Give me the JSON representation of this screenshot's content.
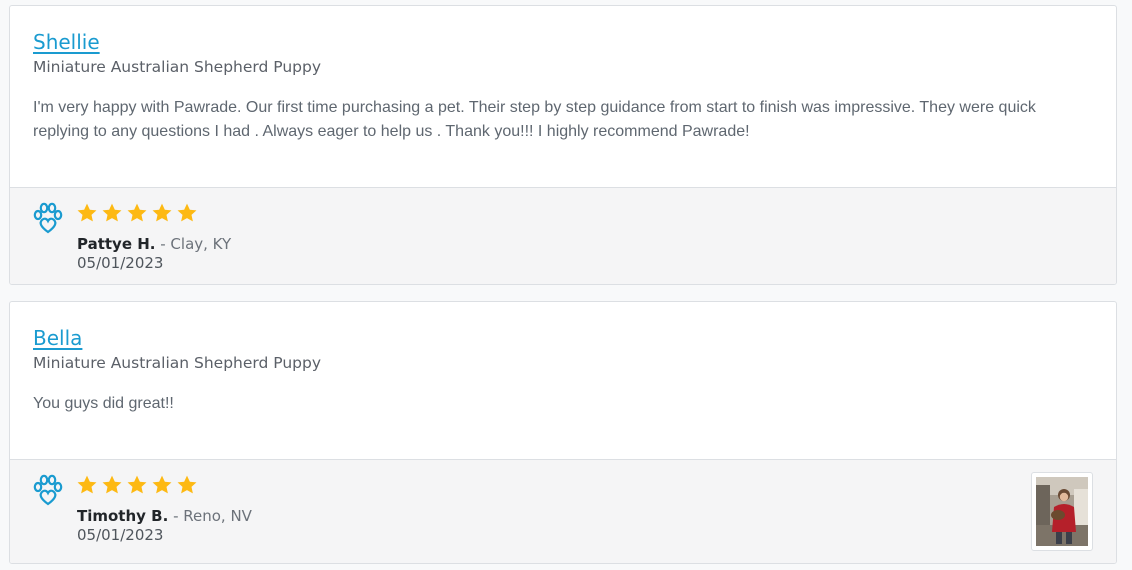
{
  "colors": {
    "link": "#1a9bd0",
    "star": "#fdb913",
    "paw": "#1a9bd0",
    "footer_bg": "#f5f5f6"
  },
  "icons": {
    "brand": "paw-heart-icon",
    "rating": "star-icon"
  },
  "reviews": [
    {
      "pet_name": "Shellie",
      "breed": "Miniature Australian Shepherd Puppy",
      "text": "I'm very happy with Pawrade. Our first time purchasing a pet. Their step by step guidance from start to finish was impressive. They were quick replying to any questions I had . Always eager to help us . Thank you!!! I highly recommend Pawrade!",
      "rating": 5,
      "reviewer": "Pattye H.",
      "location": " - Clay, KY",
      "date": "05/01/2023",
      "has_photo": false
    },
    {
      "pet_name": "Bella",
      "breed": "Miniature Australian Shepherd Puppy",
      "text": "You guys did great!!",
      "rating": 5,
      "reviewer": "Timothy B.",
      "location": " - Reno, NV",
      "date": "05/01/2023",
      "has_photo": true
    }
  ]
}
